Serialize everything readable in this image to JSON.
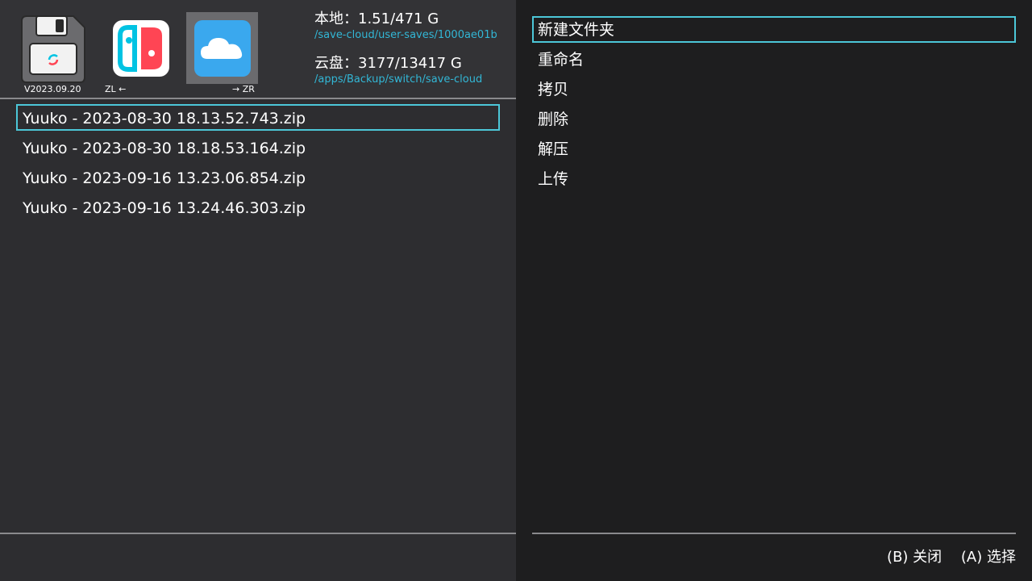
{
  "header": {
    "tabs": [
      {
        "name": "save-disk",
        "caption": "V2023.09.20"
      },
      {
        "name": "switch",
        "caption": "ZL ←"
      },
      {
        "name": "cloud",
        "caption": "→ ZR"
      }
    ],
    "local_label": "本地：1.51/471 G",
    "local_path": "/save-cloud/user-saves/1000ae01b",
    "cloud_label": "云盘：3177/13417 G",
    "cloud_path": "/apps/Backup/switch/save-cloud"
  },
  "files": [
    "Yuuko - 2023-08-30 18.13.52.743.zip",
    "Yuuko - 2023-08-30 18.18.53.164.zip",
    "Yuuko - 2023-09-16 13.23.06.854.zip",
    "Yuuko - 2023-09-16 13.24.46.303.zip"
  ],
  "menu": [
    "新建文件夹",
    "重命名",
    "拷贝",
    "删除",
    "解压",
    "上传"
  ],
  "hints": {
    "close": "(B) 关闭",
    "select": "(A) 选择"
  },
  "colors": {
    "accent": "#4cc7d8",
    "path": "#32b7d6",
    "switch_red": "#ff4554",
    "switch_blue": "#00c3e3"
  }
}
